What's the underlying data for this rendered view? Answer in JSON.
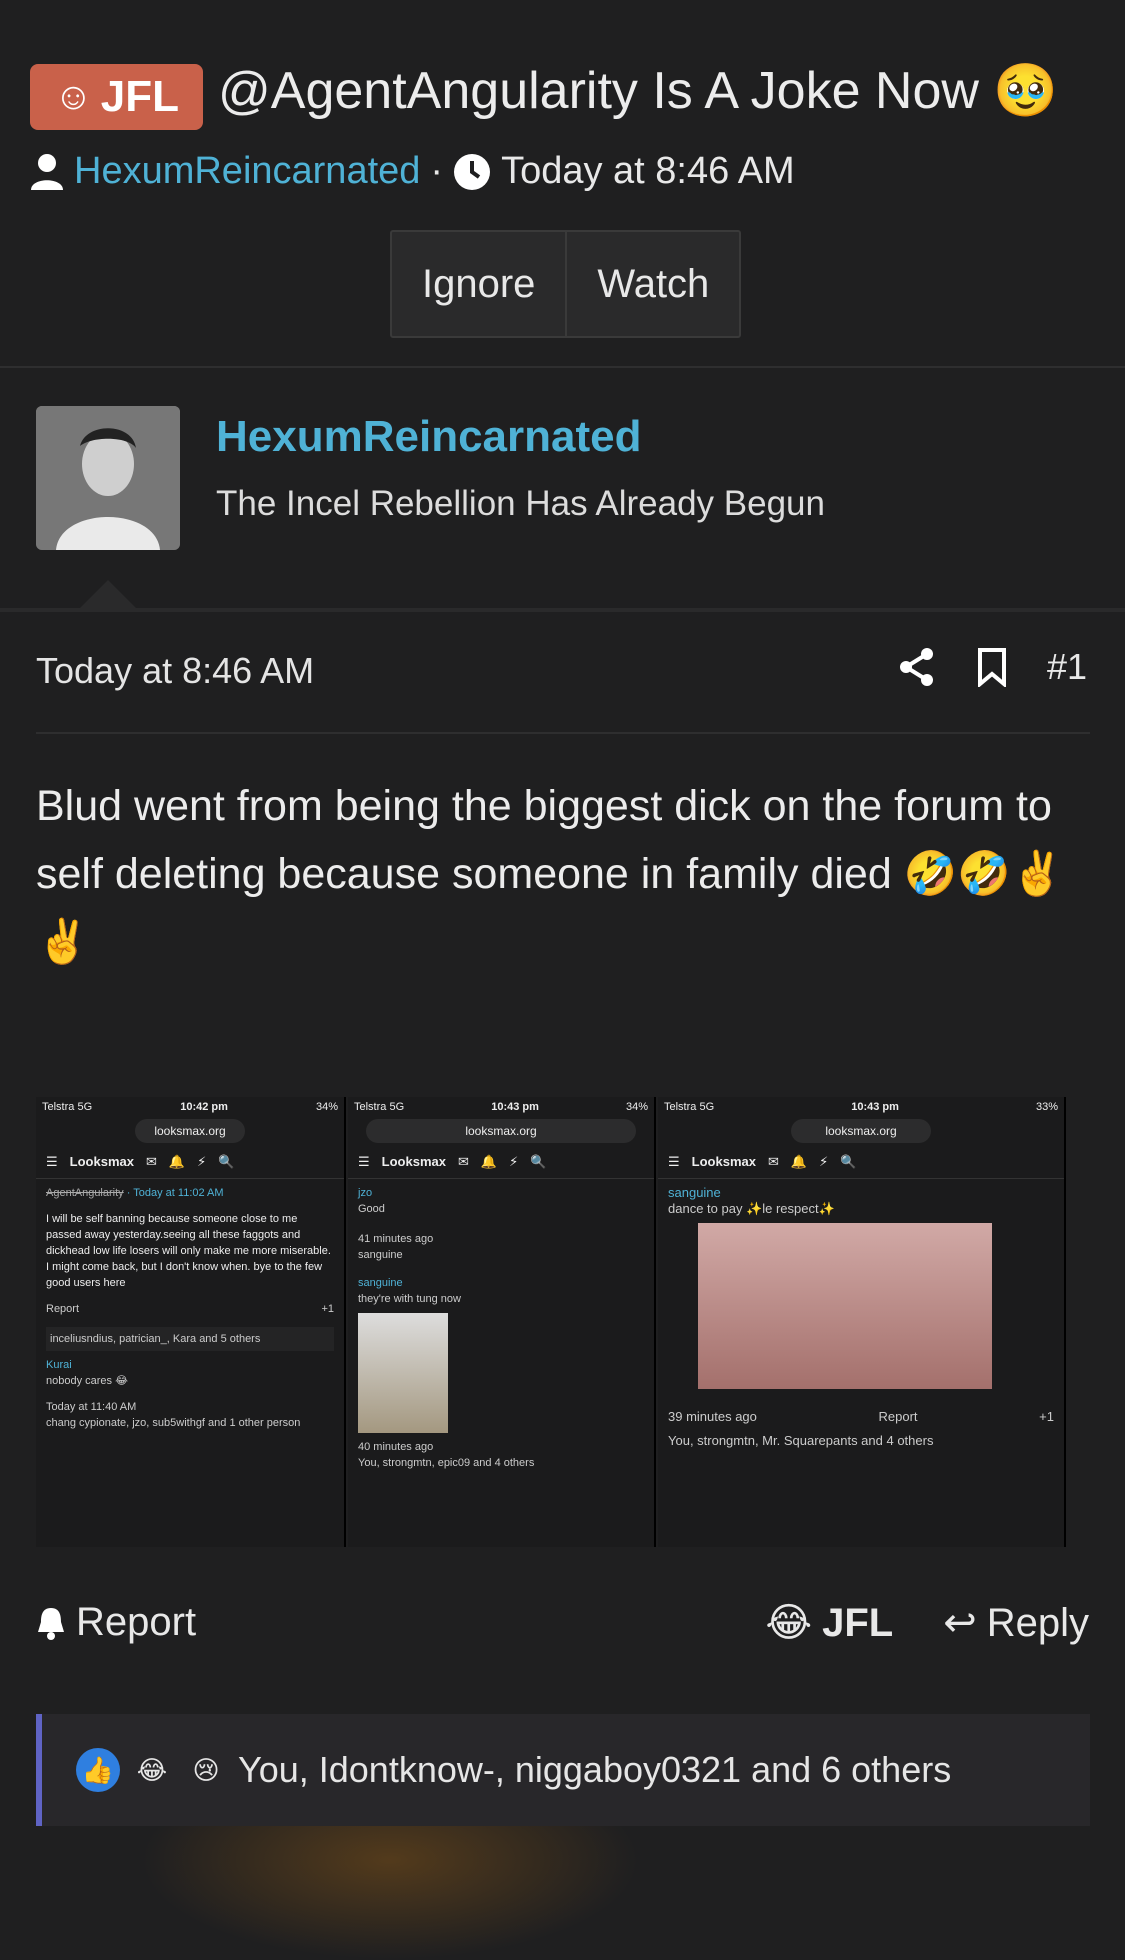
{
  "thread": {
    "prefix": "JFL",
    "title": "@AgentAngularity Is A Joke Now 🥹",
    "author": "HexumReincarnated",
    "separator": "·",
    "timestamp": "Today at 8:46 AM",
    "ignore_label": "Ignore",
    "watch_label": "Watch"
  },
  "post": {
    "username": "HexumReincarnated",
    "user_title": "The Incel Rebellion Has Already Begun",
    "timestamp": "Today at 8:46 AM",
    "number": "#1",
    "body": "Blud went from being the biggest dick on the forum to self deleting because someone in family died 🤣🤣✌️✌️",
    "report_label": "Report",
    "jfl_label": "JFL",
    "reply_label": "Reply",
    "reactions_text": "You, Idontknow-, niggaboy0321 and 6 others"
  },
  "screenshots": [
    {
      "carrier": "Telstra  5G",
      "time": "10:42 pm",
      "battery": "34%",
      "url": "looksmax.org",
      "author": "AgentAngularity",
      "author_time": "· Today at 11:02 AM",
      "text": "I will be self banning because someone close to me passed away yesterday.seeing all these faggots and dickhead low life losers will only make me more miserable. I might come back, but I don't know when. bye to the few good users here",
      "report": "Report",
      "likes": "+1",
      "reactors": "inceliusndius, patrician_, Kara and 5 others",
      "reply_user": "Kurai",
      "reply_text": "nobody cares 😂",
      "reply_time": "Today at 11:40 AM",
      "reply_reactors": "chang cypionate, jzo, sub5withgf and 1 other person"
    },
    {
      "carrier": "Telstra  5G",
      "time": "10:43 pm",
      "battery": "34%",
      "url": "looksmax.org",
      "user1": "jzo",
      "text1": "Good",
      "time1": "41 minutes ago",
      "react1": "sanguine",
      "user2": "sanguine",
      "text2": "they're with tung now",
      "time2": "40 minutes ago",
      "react2": "You, strongmtn, epic09 and 4 others"
    },
    {
      "carrier": "Telstra  5G",
      "time": "10:43 pm",
      "battery": "33%",
      "url": "looksmax.org",
      "user": "sanguine",
      "text": "dance to pay ✨le respect✨",
      "time_ago": "39 minutes ago",
      "report": "Report",
      "likes": "+1",
      "reactors": "You, strongmtn, Mr. Squarepants and 4 others"
    }
  ]
}
